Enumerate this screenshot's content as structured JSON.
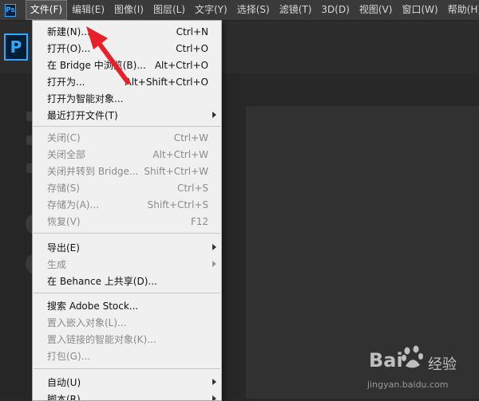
{
  "app": {
    "logo_text": "Ps",
    "home_logo_text": "P"
  },
  "menubar": {
    "items": [
      {
        "label": "文件(F)"
      },
      {
        "label": "编辑(E)"
      },
      {
        "label": "图像(I)"
      },
      {
        "label": "图层(L)"
      },
      {
        "label": "文字(Y)"
      },
      {
        "label": "选择(S)"
      },
      {
        "label": "滤镜(T)"
      },
      {
        "label": "3D(D)"
      },
      {
        "label": "视图(V)"
      },
      {
        "label": "窗口(W)"
      },
      {
        "label": "帮助(H)"
      }
    ],
    "active_index": 0
  },
  "file_menu": {
    "items": [
      {
        "label": "新建(N)...",
        "shortcut": "Ctrl+N",
        "enabled": true,
        "submenu": false
      },
      {
        "label": "打开(O)...",
        "shortcut": "Ctrl+O",
        "enabled": true,
        "submenu": false
      },
      {
        "label": "在 Bridge 中浏览(B)...",
        "shortcut": "Alt+Ctrl+O",
        "enabled": true,
        "submenu": false
      },
      {
        "label": "打开为...",
        "shortcut": "Alt+Shift+Ctrl+O",
        "enabled": true,
        "submenu": false
      },
      {
        "label": "打开为智能对象...",
        "shortcut": "",
        "enabled": true,
        "submenu": false
      },
      {
        "label": "最近打开文件(T)",
        "shortcut": "",
        "enabled": true,
        "submenu": true
      },
      {
        "label": "关闭(C)",
        "shortcut": "Ctrl+W",
        "enabled": false,
        "submenu": false
      },
      {
        "label": "关闭全部",
        "shortcut": "Alt+Ctrl+W",
        "enabled": false,
        "submenu": false
      },
      {
        "label": "关闭并转到 Bridge...",
        "shortcut": "Shift+Ctrl+W",
        "enabled": false,
        "submenu": false
      },
      {
        "label": "存储(S)",
        "shortcut": "Ctrl+S",
        "enabled": false,
        "submenu": false
      },
      {
        "label": "存储为(A)...",
        "shortcut": "Shift+Ctrl+S",
        "enabled": false,
        "submenu": false
      },
      {
        "label": "恢复(V)",
        "shortcut": "F12",
        "enabled": false,
        "submenu": false
      },
      {
        "label": "导出(E)",
        "shortcut": "",
        "enabled": true,
        "submenu": true
      },
      {
        "label": "生成",
        "shortcut": "",
        "enabled": false,
        "submenu": true
      },
      {
        "label": "在 Behance 上共享(D)...",
        "shortcut": "",
        "enabled": true,
        "submenu": false
      },
      {
        "label": "搜索 Adobe Stock...",
        "shortcut": "",
        "enabled": true,
        "submenu": false
      },
      {
        "label": "置入嵌入对象(L)...",
        "shortcut": "",
        "enabled": false,
        "submenu": false
      },
      {
        "label": "置入链接的智能对象(K)...",
        "shortcut": "",
        "enabled": false,
        "submenu": false
      },
      {
        "label": "打包(G)...",
        "shortcut": "",
        "enabled": false,
        "submenu": false
      },
      {
        "label": "自动(U)",
        "shortcut": "",
        "enabled": true,
        "submenu": true
      },
      {
        "label": "脚本(R)",
        "shortcut": "",
        "enabled": true,
        "submenu": true
      }
    ]
  },
  "watermark": {
    "logo": "Bai",
    "logo_suffix": "经验",
    "url": "jingyan.baidu.com"
  },
  "colors": {
    "annotation_arrow": "#e8202a",
    "accent": "#31a8ff"
  }
}
